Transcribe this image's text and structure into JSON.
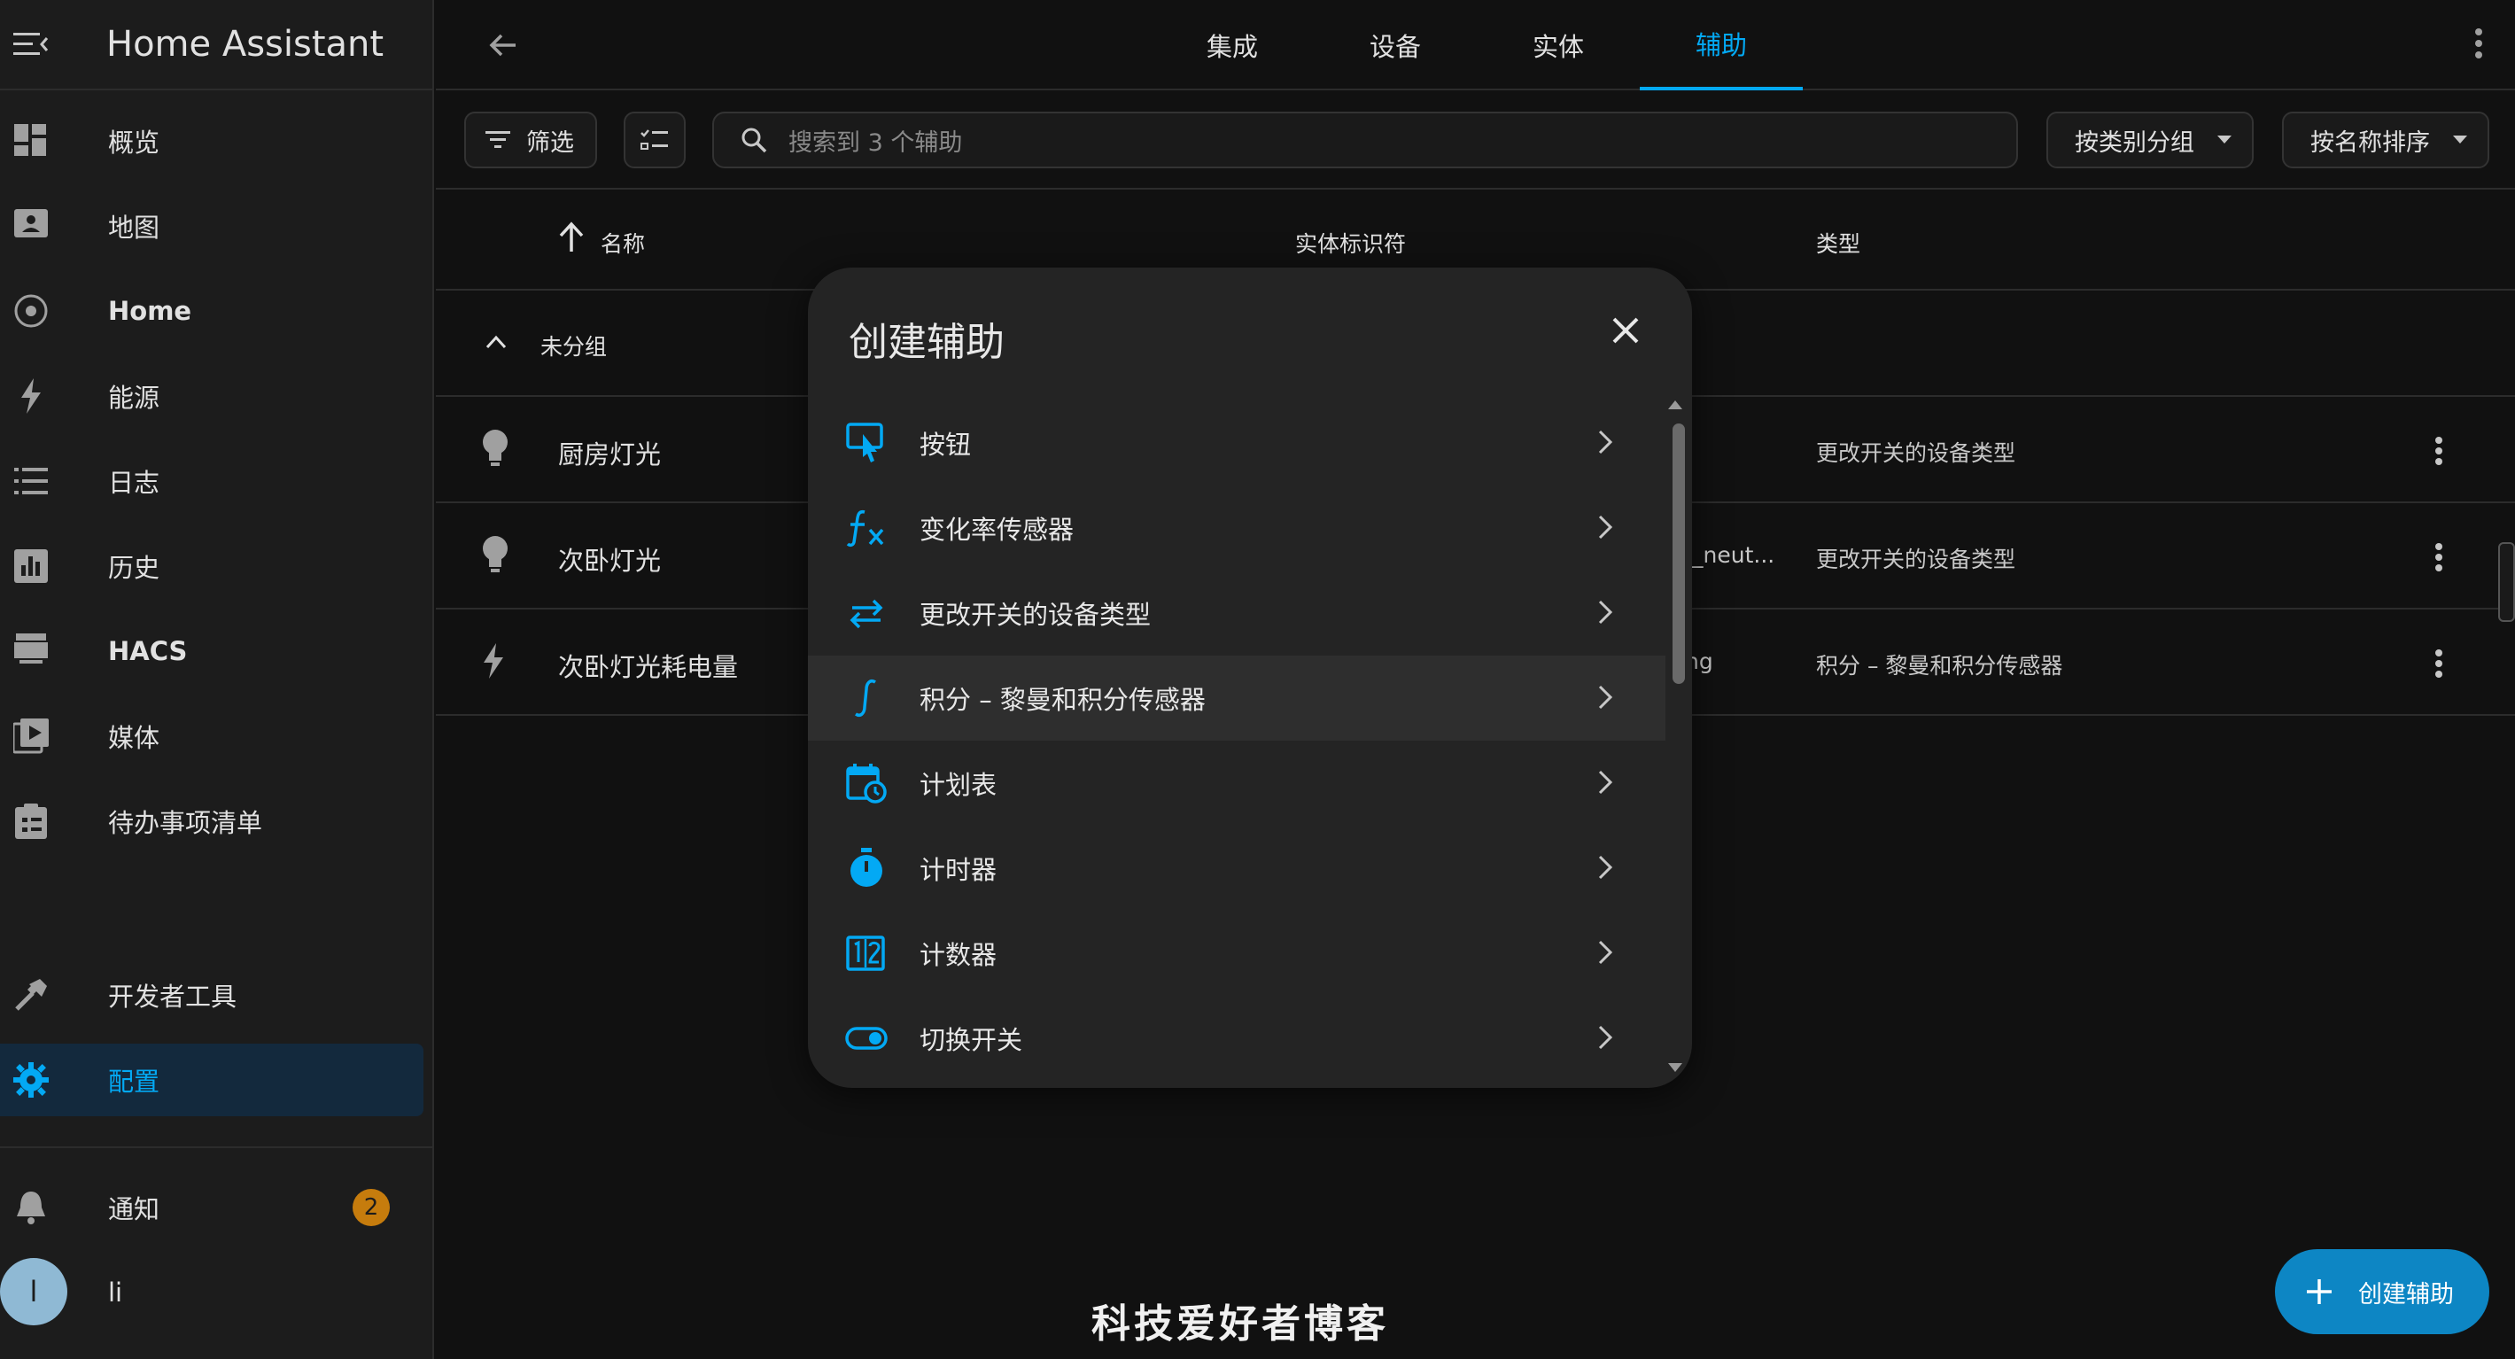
{
  "app": {
    "title": "Home Assistant"
  },
  "sidebar": {
    "items": [
      {
        "label": "概览",
        "icon": "dashboard-icon"
      },
      {
        "label": "地图",
        "icon": "map-icon"
      },
      {
        "label": "Home",
        "icon": "home-dial-icon"
      },
      {
        "label": "能源",
        "icon": "lightning-icon"
      },
      {
        "label": "日志",
        "icon": "list-icon"
      },
      {
        "label": "历史",
        "icon": "chart-icon"
      },
      {
        "label": "HACS",
        "icon": "hacs-icon"
      },
      {
        "label": "媒体",
        "icon": "media-icon"
      },
      {
        "label": "待办事项清单",
        "icon": "clipboard-icon"
      }
    ],
    "dev_tools": "开发者工具",
    "config": "配置",
    "notifications": "通知",
    "notification_count": "2",
    "user_initial": "l",
    "user_name": "li"
  },
  "topbar": {
    "tabs": [
      "集成",
      "设备",
      "实体",
      "辅助"
    ],
    "active_tab": "辅助"
  },
  "toolbar": {
    "filter_label": "筛选",
    "search_placeholder": "搜索到 3 个辅助",
    "group_by": "按类别分组",
    "sort_by": "按名称排序"
  },
  "table": {
    "columns": {
      "name": "名称",
      "entity_id": "实体标识符",
      "type": "类型"
    },
    "group_label": "未分组",
    "rows": [
      {
        "name": "厨房灯光",
        "entity_id": "",
        "type": "更改开关的设备类型",
        "icon": "bulb-icon"
      },
      {
        "name": "次卧灯光",
        "entity_id": "_neut...",
        "type": "更改开关的设备类型",
        "icon": "bulb-icon"
      },
      {
        "name": "次卧灯光耗电量",
        "entity_id": "ng",
        "type": "积分 – 黎曼和积分传感器",
        "icon": "lightning-icon"
      }
    ]
  },
  "dialog": {
    "title": "创建辅助",
    "items": [
      {
        "label": "按钮",
        "icon": "button-touch-icon"
      },
      {
        "label": "变化率传感器",
        "icon": "function-icon"
      },
      {
        "label": "更改开关的设备类型",
        "icon": "swap-arrows-icon"
      },
      {
        "label": "积分 – 黎曼和积分传感器",
        "icon": "integral-icon"
      },
      {
        "label": "计划表",
        "icon": "calendar-clock-icon"
      },
      {
        "label": "计时器",
        "icon": "timer-icon"
      },
      {
        "label": "计数器",
        "icon": "counter-icon"
      },
      {
        "label": "切换开关",
        "icon": "toggle-icon"
      }
    ]
  },
  "fab": {
    "label": "创建辅助"
  },
  "watermark": "科技爱好者博客",
  "colors": {
    "accent": "#03a9f4",
    "background": "#111111",
    "sidebar": "#1c1c1c",
    "dialog": "#242424",
    "badge": "#c67c0d",
    "fab": "#0d86c4"
  }
}
